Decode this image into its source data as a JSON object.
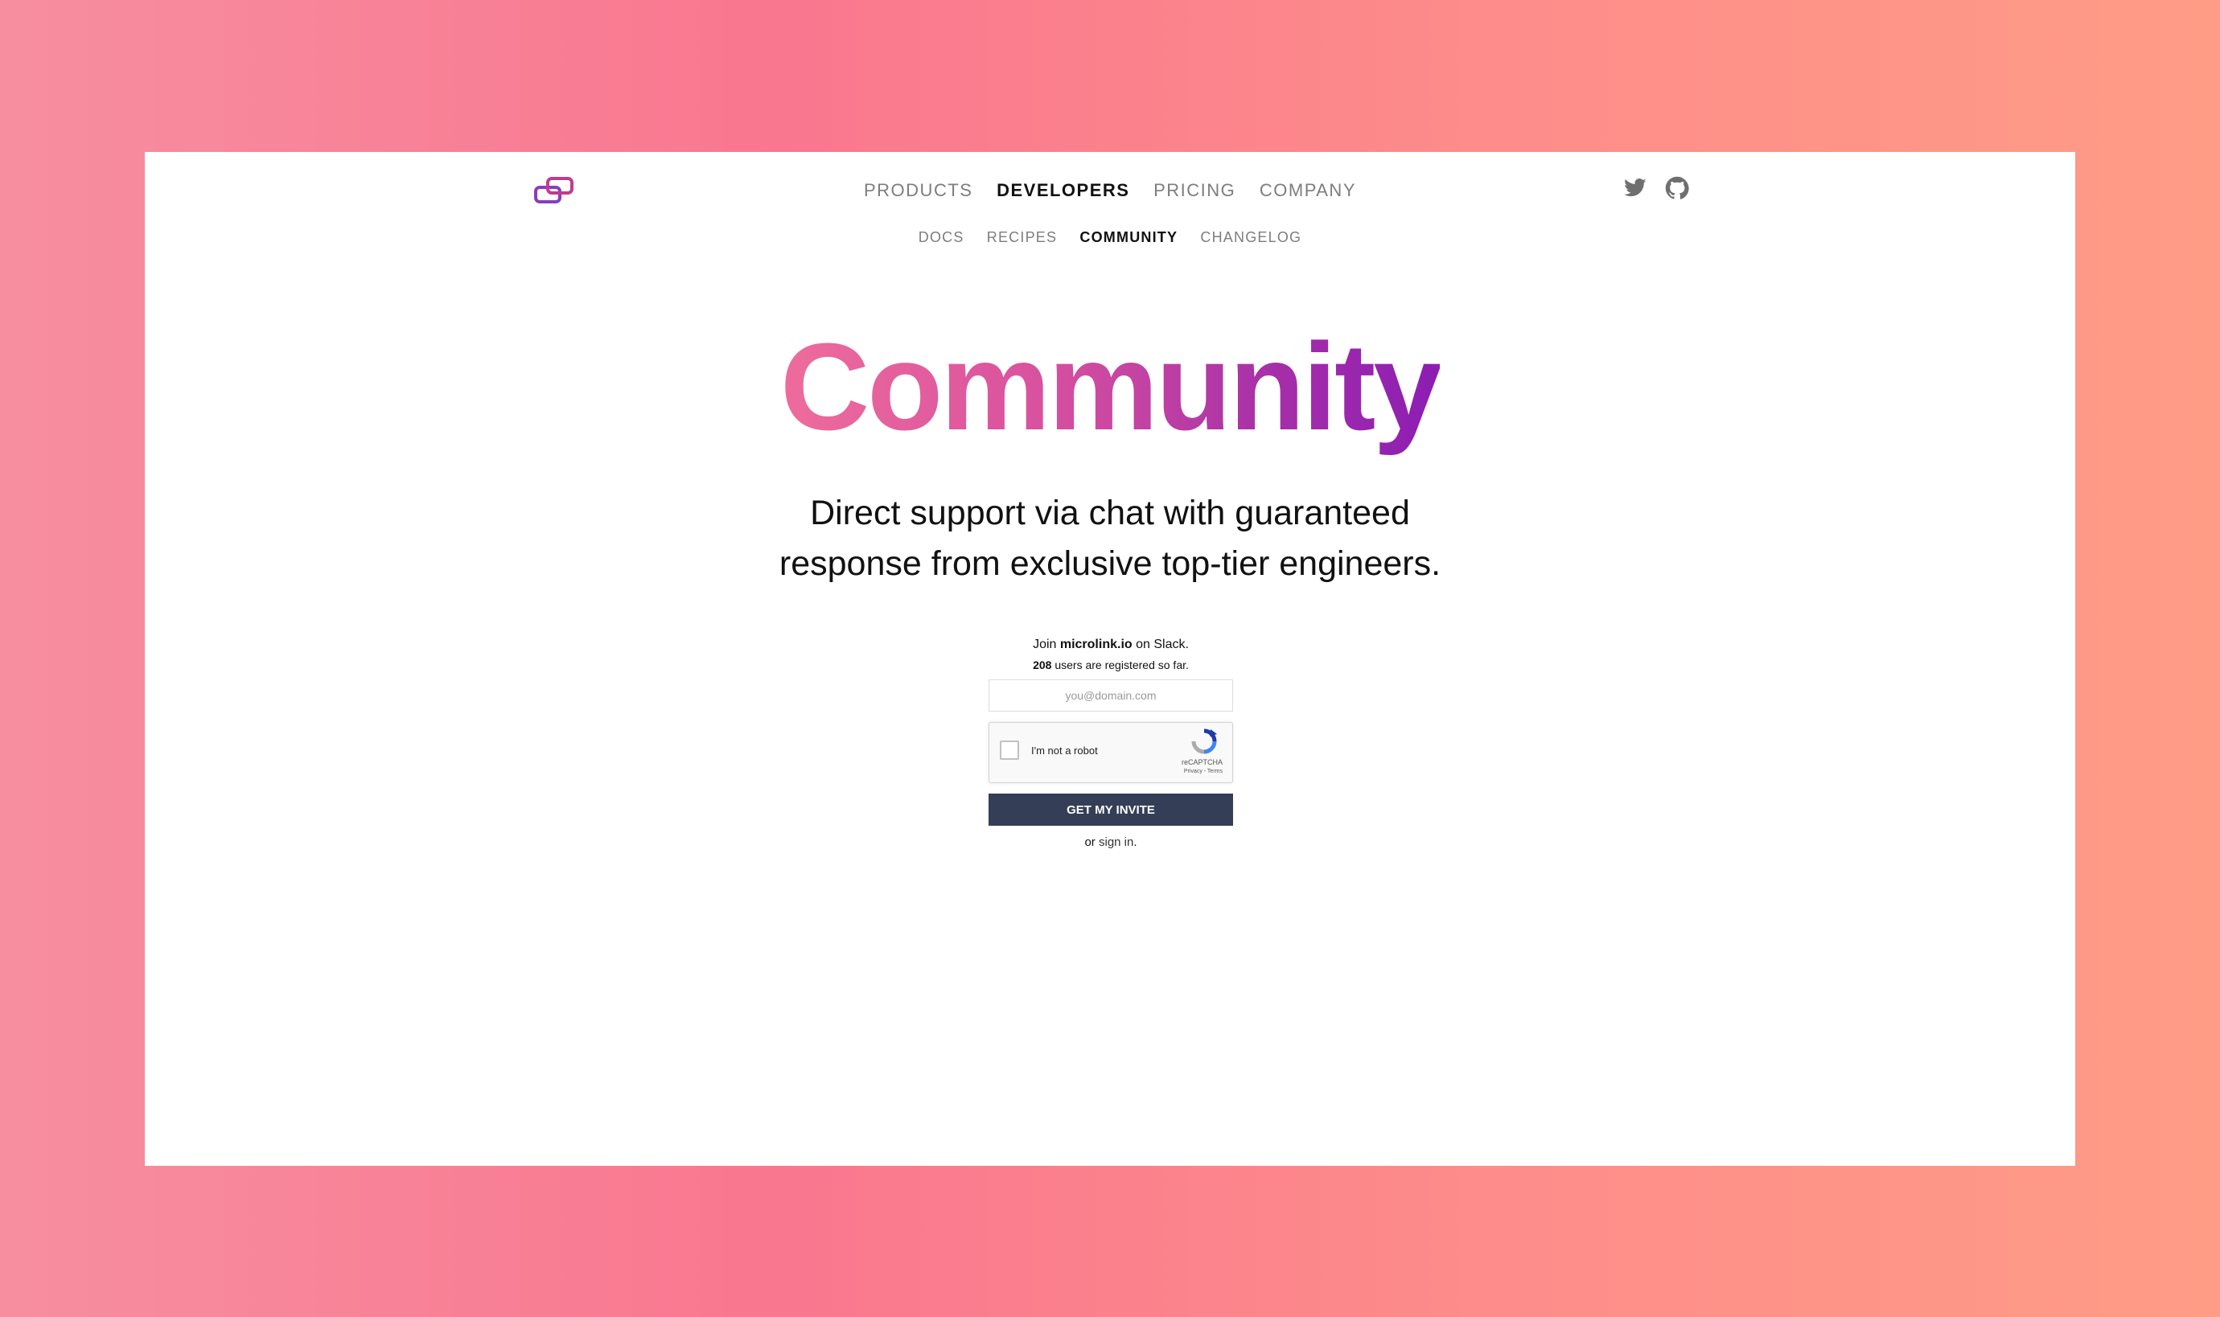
{
  "nav": {
    "primary": [
      {
        "label": "PRODUCTS",
        "active": false
      },
      {
        "label": "DEVELOPERS",
        "active": true
      },
      {
        "label": "PRICING",
        "active": false
      },
      {
        "label": "COMPANY",
        "active": false
      }
    ],
    "secondary": [
      {
        "label": "DOCS",
        "active": false
      },
      {
        "label": "RECIPES",
        "active": false
      },
      {
        "label": "COMMUNITY",
        "active": true
      },
      {
        "label": "CHANGELOG",
        "active": false
      }
    ],
    "social_icons": [
      "twitter-icon",
      "github-icon"
    ]
  },
  "hero": {
    "title": "Community",
    "subtitle_line1": "Direct support via chat with guaranteed",
    "subtitle_line2": "response from exclusive top-tier engineers."
  },
  "slack": {
    "join_prefix": "Join ",
    "join_brand": "microlink.io",
    "join_suffix": " on Slack.",
    "count": "208",
    "count_suffix": " users are registered so far.",
    "email_placeholder": "you@domain.com",
    "recaptcha_label": "I'm not a robot",
    "recaptcha_brand": "reCAPTCHA",
    "recaptcha_terms": "Privacy - Terms",
    "button_label": "GET MY INVITE",
    "signin_prefix": "or ",
    "signin_link": "sign in",
    "signin_suffix": "."
  },
  "colors": {
    "accent_button": "#343e56",
    "title_gradient_start": "#ee6c9c",
    "title_gradient_end": "#8c1db3",
    "logo": "#8c3bbd"
  }
}
